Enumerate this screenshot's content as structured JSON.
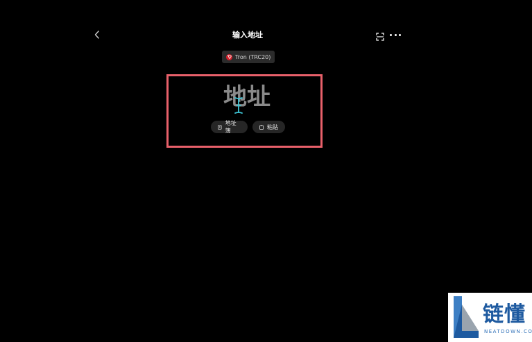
{
  "header": {
    "title": "输入地址",
    "back_icon": "chevron-left-icon",
    "scan_icon": "scan-icon",
    "more_icon": "more-dots-icon"
  },
  "network": {
    "label": "Tron (TRC20)",
    "icon": "tron-icon",
    "icon_color": "#d3202b"
  },
  "address_input": {
    "value": "",
    "placeholder": "地址"
  },
  "actions": {
    "address_book_label": "地址簿",
    "paste_label": "粘贴"
  },
  "highlight": {
    "color": "#e8606a"
  },
  "watermark": {
    "text": "链懂",
    "subtext": "NEATDOWN.COM"
  }
}
